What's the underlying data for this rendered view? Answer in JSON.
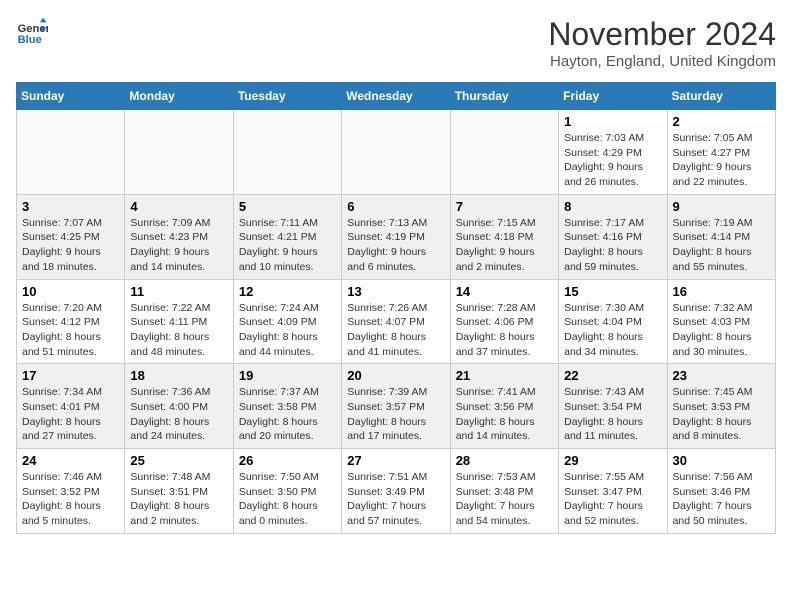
{
  "logo": {
    "line1": "General",
    "line2": "Blue"
  },
  "title": "November 2024",
  "subtitle": "Hayton, England, United Kingdom",
  "headers": [
    "Sunday",
    "Monday",
    "Tuesday",
    "Wednesday",
    "Thursday",
    "Friday",
    "Saturday"
  ],
  "weeks": [
    [
      {
        "day": "",
        "info": ""
      },
      {
        "day": "",
        "info": ""
      },
      {
        "day": "",
        "info": ""
      },
      {
        "day": "",
        "info": ""
      },
      {
        "day": "",
        "info": ""
      },
      {
        "day": "1",
        "info": "Sunrise: 7:03 AM\nSunset: 4:29 PM\nDaylight: 9 hours and 26 minutes."
      },
      {
        "day": "2",
        "info": "Sunrise: 7:05 AM\nSunset: 4:27 PM\nDaylight: 9 hours and 22 minutes."
      }
    ],
    [
      {
        "day": "3",
        "info": "Sunrise: 7:07 AM\nSunset: 4:25 PM\nDaylight: 9 hours and 18 minutes."
      },
      {
        "day": "4",
        "info": "Sunrise: 7:09 AM\nSunset: 4:23 PM\nDaylight: 9 hours and 14 minutes."
      },
      {
        "day": "5",
        "info": "Sunrise: 7:11 AM\nSunset: 4:21 PM\nDaylight: 9 hours and 10 minutes."
      },
      {
        "day": "6",
        "info": "Sunrise: 7:13 AM\nSunset: 4:19 PM\nDaylight: 9 hours and 6 minutes."
      },
      {
        "day": "7",
        "info": "Sunrise: 7:15 AM\nSunset: 4:18 PM\nDaylight: 9 hours and 2 minutes."
      },
      {
        "day": "8",
        "info": "Sunrise: 7:17 AM\nSunset: 4:16 PM\nDaylight: 8 hours and 59 minutes."
      },
      {
        "day": "9",
        "info": "Sunrise: 7:19 AM\nSunset: 4:14 PM\nDaylight: 8 hours and 55 minutes."
      }
    ],
    [
      {
        "day": "10",
        "info": "Sunrise: 7:20 AM\nSunset: 4:12 PM\nDaylight: 8 hours and 51 minutes."
      },
      {
        "day": "11",
        "info": "Sunrise: 7:22 AM\nSunset: 4:11 PM\nDaylight: 8 hours and 48 minutes."
      },
      {
        "day": "12",
        "info": "Sunrise: 7:24 AM\nSunset: 4:09 PM\nDaylight: 8 hours and 44 minutes."
      },
      {
        "day": "13",
        "info": "Sunrise: 7:26 AM\nSunset: 4:07 PM\nDaylight: 8 hours and 41 minutes."
      },
      {
        "day": "14",
        "info": "Sunrise: 7:28 AM\nSunset: 4:06 PM\nDaylight: 8 hours and 37 minutes."
      },
      {
        "day": "15",
        "info": "Sunrise: 7:30 AM\nSunset: 4:04 PM\nDaylight: 8 hours and 34 minutes."
      },
      {
        "day": "16",
        "info": "Sunrise: 7:32 AM\nSunset: 4:03 PM\nDaylight: 8 hours and 30 minutes."
      }
    ],
    [
      {
        "day": "17",
        "info": "Sunrise: 7:34 AM\nSunset: 4:01 PM\nDaylight: 8 hours and 27 minutes."
      },
      {
        "day": "18",
        "info": "Sunrise: 7:36 AM\nSunset: 4:00 PM\nDaylight: 8 hours and 24 minutes."
      },
      {
        "day": "19",
        "info": "Sunrise: 7:37 AM\nSunset: 3:58 PM\nDaylight: 8 hours and 20 minutes."
      },
      {
        "day": "20",
        "info": "Sunrise: 7:39 AM\nSunset: 3:57 PM\nDaylight: 8 hours and 17 minutes."
      },
      {
        "day": "21",
        "info": "Sunrise: 7:41 AM\nSunset: 3:56 PM\nDaylight: 8 hours and 14 minutes."
      },
      {
        "day": "22",
        "info": "Sunrise: 7:43 AM\nSunset: 3:54 PM\nDaylight: 8 hours and 11 minutes."
      },
      {
        "day": "23",
        "info": "Sunrise: 7:45 AM\nSunset: 3:53 PM\nDaylight: 8 hours and 8 minutes."
      }
    ],
    [
      {
        "day": "24",
        "info": "Sunrise: 7:46 AM\nSunset: 3:52 PM\nDaylight: 8 hours and 5 minutes."
      },
      {
        "day": "25",
        "info": "Sunrise: 7:48 AM\nSunset: 3:51 PM\nDaylight: 8 hours and 2 minutes."
      },
      {
        "day": "26",
        "info": "Sunrise: 7:50 AM\nSunset: 3:50 PM\nDaylight: 8 hours and 0 minutes."
      },
      {
        "day": "27",
        "info": "Sunrise: 7:51 AM\nSunset: 3:49 PM\nDaylight: 7 hours and 57 minutes."
      },
      {
        "day": "28",
        "info": "Sunrise: 7:53 AM\nSunset: 3:48 PM\nDaylight: 7 hours and 54 minutes."
      },
      {
        "day": "29",
        "info": "Sunrise: 7:55 AM\nSunset: 3:47 PM\nDaylight: 7 hours and 52 minutes."
      },
      {
        "day": "30",
        "info": "Sunrise: 7:56 AM\nSunset: 3:46 PM\nDaylight: 7 hours and 50 minutes."
      }
    ]
  ]
}
